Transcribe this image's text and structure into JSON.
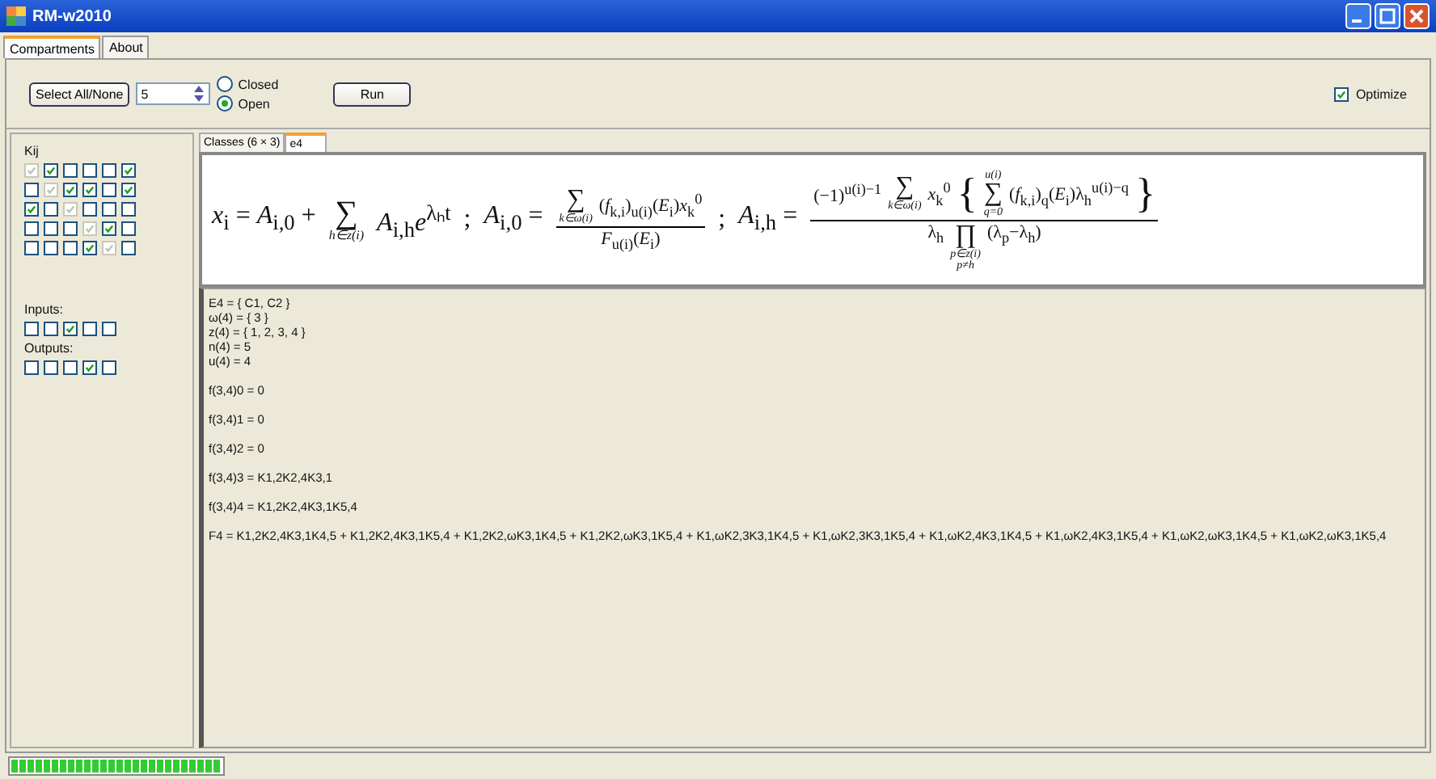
{
  "window": {
    "title": "RM-w2010"
  },
  "tabs": [
    {
      "label": "Compartments",
      "selected": true
    },
    {
      "label": "About",
      "selected": false
    }
  ],
  "toolbar": {
    "select_button": "Select All/None",
    "number": "5",
    "radios": [
      {
        "label": "Closed",
        "selected": false
      },
      {
        "label": "Open",
        "selected": true
      }
    ],
    "run_button": "Run",
    "optimize": {
      "label": "Optimize",
      "checked": true
    }
  },
  "kij": {
    "label": "Kij",
    "rows": [
      [
        {
          "checked": true,
          "disabled": true
        },
        {
          "checked": true,
          "disabled": false
        },
        {
          "checked": false,
          "disabled": false
        },
        {
          "checked": false,
          "disabled": false
        },
        {
          "checked": false,
          "disabled": false
        },
        {
          "checked": true,
          "disabled": false
        }
      ],
      [
        {
          "checked": false,
          "disabled": false
        },
        {
          "checked": true,
          "disabled": true
        },
        {
          "checked": true,
          "disabled": false
        },
        {
          "checked": true,
          "disabled": false
        },
        {
          "checked": false,
          "disabled": false
        },
        {
          "checked": true,
          "disabled": false
        }
      ],
      [
        {
          "checked": true,
          "disabled": false
        },
        {
          "checked": false,
          "disabled": false
        },
        {
          "checked": true,
          "disabled": true
        },
        {
          "checked": false,
          "disabled": false
        },
        {
          "checked": false,
          "disabled": false
        },
        {
          "checked": false,
          "disabled": false
        }
      ],
      [
        {
          "checked": false,
          "disabled": false
        },
        {
          "checked": false,
          "disabled": false
        },
        {
          "checked": false,
          "disabled": false
        },
        {
          "checked": true,
          "disabled": true
        },
        {
          "checked": true,
          "disabled": false
        },
        {
          "checked": false,
          "disabled": false
        }
      ],
      [
        {
          "checked": false,
          "disabled": false
        },
        {
          "checked": false,
          "disabled": false
        },
        {
          "checked": false,
          "disabled": false
        },
        {
          "checked": true,
          "disabled": false
        },
        {
          "checked": true,
          "disabled": true
        },
        {
          "checked": false,
          "disabled": false
        }
      ]
    ]
  },
  "inputs": {
    "label": "Inputs:",
    "boxes": [
      {
        "checked": false
      },
      {
        "checked": false
      },
      {
        "checked": true
      },
      {
        "checked": false
      },
      {
        "checked": false
      }
    ]
  },
  "outputs": {
    "label": "Outputs:",
    "boxes": [
      {
        "checked": false
      },
      {
        "checked": false
      },
      {
        "checked": false
      },
      {
        "checked": true
      },
      {
        "checked": false
      }
    ]
  },
  "inner_tabs": [
    {
      "label": "Classes (6 × 3)",
      "selected": false
    },
    {
      "label": "e4",
      "selected": true
    }
  ],
  "formula": [
    {
      "kind": "text",
      "text": "*x*$_{i}$ = *A*$_{i,0}$ +"
    },
    {
      "kind": "sum",
      "symbol": "∑",
      "under": [
        "h∈z(i)"
      ]
    },
    {
      "kind": "text",
      "text": "*A*$_{i,h}$*e*$^{λₕt}$"
    },
    {
      "kind": "text",
      "text": ";"
    },
    {
      "kind": "text",
      "text": "*A*$_{i,0}$ ="
    },
    {
      "kind": "fraction",
      "numerator": [
        {
          "kind": "sum",
          "symbol": "∑",
          "under": [
            "k∈ω(i)"
          ]
        },
        {
          "kind": "text",
          "text": "(*f*$_{k,i}$)$_{u(i)}$(*E*$_{i}$)*x*$_{k}$$^{0}$"
        }
      ],
      "denominator": [
        {
          "kind": "text",
          "text": "*F*$_{u(i)}$(*E*$_{i}$)"
        }
      ]
    },
    {
      "kind": "text",
      "text": ";"
    },
    {
      "kind": "text",
      "text": "*A*$_{i,h}$ ="
    },
    {
      "kind": "fraction",
      "numerator": [
        {
          "kind": "text",
          "text": "(−1)$^{u(i)−1}$"
        },
        {
          "kind": "sum",
          "symbol": "∑",
          "under": [
            "k∈ω(i)"
          ]
        },
        {
          "kind": "text",
          "text": "*x*$_{k}$$^{0}$"
        },
        {
          "kind": "brace",
          "text": "{"
        },
        {
          "kind": "sum",
          "symbol": "∑",
          "over": "u(i)",
          "under": [
            "q=0"
          ]
        },
        {
          "kind": "text",
          "text": "(*f*$_{k,i}$)$_{q}$(*E*$_{i}$)λ$_{h}$$^{u(i)−q}$"
        },
        {
          "kind": "brace",
          "text": "}"
        }
      ],
      "denominator": [
        {
          "kind": "text",
          "text": "λ$_{h}$"
        },
        {
          "kind": "sum",
          "symbol": "∏",
          "under": [
            "p∈z(i)",
            "p≠h"
          ]
        },
        {
          "kind": "text",
          "text": "(λ$_{p}$−λ$_{h}$)"
        }
      ]
    }
  ],
  "output_groups": [
    [
      "E4 = { C1, C2 }",
      "ω(4) = { 3 }",
      "z(4) = { 1, 2, 3, 4 }",
      "n(4) = 5",
      "u(4) = 4"
    ],
    [
      "f(3,4)0 = 0"
    ],
    [
      "f(3,4)1 = 0"
    ],
    [
      "f(3,4)2 = 0"
    ],
    [
      "f(3,4)3 = K1,2K2,4K3,1"
    ],
    [
      "f(3,4)4 = K1,2K2,4K3,1K5,4"
    ],
    [
      "F4 = K1,2K2,4K3,1K4,5 + K1,2K2,4K3,1K5,4 + K1,2K2,ωK3,1K4,5 + K1,2K2,ωK3,1K5,4 + K1,ωK2,3K3,1K4,5 + K1,ωK2,3K3,1K5,4 + K1,ωK2,4K3,1K4,5 + K1,ωK2,4K3,1K5,4 + K1,ωK2,ωK3,1K4,5 + K1,ωK2,ωK3,1K5,4"
    ]
  ],
  "progress": {
    "level": 1
  }
}
